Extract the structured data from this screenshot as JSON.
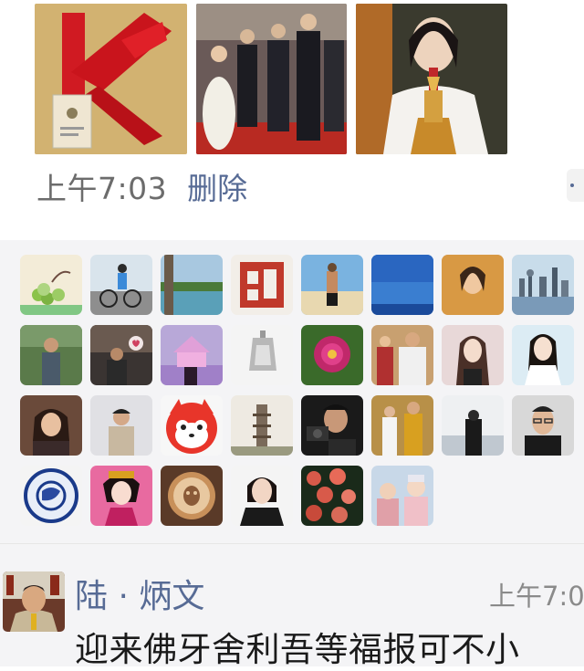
{
  "post": {
    "photos": [
      {
        "name": "red-lanyard-photo"
      },
      {
        "name": "wedding-procession-photo"
      },
      {
        "name": "woman-with-relic-photo"
      }
    ],
    "time": "上午7:03",
    "delete_label": "删除"
  },
  "likes": {
    "avatars": [
      "grapes-painting",
      "cyclist",
      "lakeside-trees",
      "red-seal",
      "beach-man",
      "blue-sky",
      "portrait-warm",
      "city-skyline",
      "man-in-park",
      "man-with-heart-sign",
      "lit-temple",
      "silver-pendant",
      "peony-flower",
      "couple-portrait",
      "woman-long-hair",
      "woman-white-dress",
      "woman-with-rings",
      "man-in-shirt",
      "cartoon-red-fox",
      "pagoda-painting",
      "man-with-camera",
      "wedding-couple",
      "man-by-sea",
      "man-with-glasses",
      "blue-white-plate",
      "costume-woman",
      "latte-art",
      "woman-dark-jacket",
      "lotus-pond",
      "two-children"
    ]
  },
  "comment": {
    "author": "陆 · 炳文",
    "time": "上午7:0",
    "text": "迎来佛牙舍利吾等福报可不小"
  }
}
